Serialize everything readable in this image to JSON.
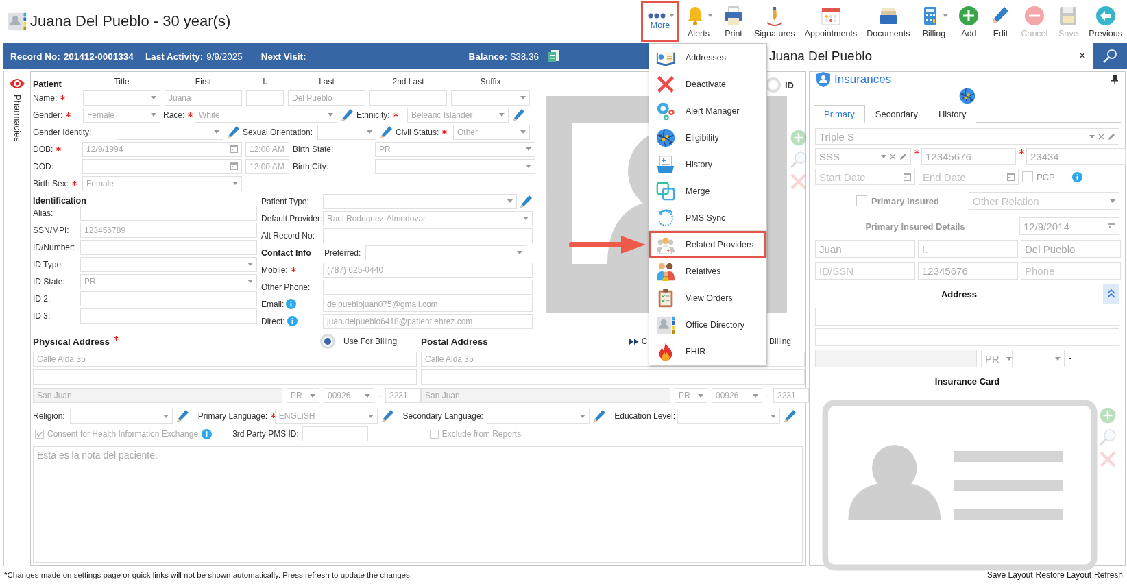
{
  "header": {
    "title": "Juana Del Pueblo - 30 year(s)"
  },
  "toolbar": [
    {
      "label": "More",
      "kind": "more",
      "dropdown": true,
      "highlighted": true,
      "disabled": false
    },
    {
      "label": "Alerts",
      "kind": "alerts",
      "dropdown": true,
      "highlighted": false,
      "disabled": false
    },
    {
      "label": "Print",
      "kind": "print",
      "dropdown": false,
      "highlighted": false,
      "disabled": false
    },
    {
      "label": "Signatures",
      "kind": "signatures",
      "dropdown": false,
      "highlighted": false,
      "disabled": false
    },
    {
      "label": "Appointments",
      "kind": "appointments",
      "dropdown": false,
      "highlighted": false,
      "disabled": false
    },
    {
      "label": "Documents",
      "kind": "documents",
      "dropdown": false,
      "highlighted": false,
      "disabled": false
    },
    {
      "label": "Billing",
      "kind": "billing",
      "dropdown": true,
      "highlighted": false,
      "disabled": false
    },
    {
      "label": "Add",
      "kind": "add",
      "dropdown": false,
      "highlighted": false,
      "disabled": false
    },
    {
      "label": "Edit",
      "kind": "edit",
      "dropdown": false,
      "highlighted": false,
      "disabled": false
    },
    {
      "label": "Cancel",
      "kind": "cancel",
      "dropdown": false,
      "highlighted": false,
      "disabled": true
    },
    {
      "label": "Save",
      "kind": "save",
      "dropdown": false,
      "highlighted": false,
      "disabled": true
    },
    {
      "label": "Previous",
      "kind": "previous",
      "dropdown": false,
      "highlighted": false,
      "disabled": false
    }
  ],
  "record_bar": {
    "record_label": "Record No:",
    "record_no": "201412-0001334",
    "activity_label": "Last Activity:",
    "last_activity": "9/9/2025",
    "next_visit_label": "Next Visit:",
    "balance_label": "Balance:",
    "balance": "$38.36"
  },
  "sidebar": {
    "label": "Pharmacies"
  },
  "more_menu": {
    "pointer_arrow": true,
    "items": [
      {
        "label": "Addresses",
        "kind": "addresses",
        "highlighted": false
      },
      {
        "label": "Deactivate",
        "kind": "deactivate",
        "highlighted": false
      },
      {
        "label": "Alert Manager",
        "kind": "alert_manager",
        "highlighted": false
      },
      {
        "label": "Eligibility",
        "kind": "eligibility",
        "highlighted": false
      },
      {
        "label": "History",
        "kind": "history",
        "highlighted": false
      },
      {
        "label": "Merge",
        "kind": "merge",
        "highlighted": false
      },
      {
        "label": "PMS Sync",
        "kind": "pms_sync",
        "highlighted": false
      },
      {
        "label": "Related Providers",
        "kind": "related_providers",
        "highlighted": true
      },
      {
        "label": "Relatives",
        "kind": "relatives",
        "highlighted": false
      },
      {
        "label": "View Orders",
        "kind": "view_orders",
        "highlighted": false
      },
      {
        "label": "Office Directory",
        "kind": "office_directory",
        "highlighted": false
      },
      {
        "label": "FHIR",
        "kind": "fhir",
        "highlighted": false
      }
    ]
  },
  "patient": {
    "heading": "Patient",
    "columns": [
      "Title",
      "First",
      "I.",
      "Last",
      "2nd Last",
      "Suffix"
    ],
    "name": {
      "label": "Name:",
      "required": true,
      "parts": [
        {
          "kind": "select"
        },
        {
          "kind": "text",
          "value": "Juana"
        },
        {
          "kind": "text"
        },
        {
          "kind": "text",
          "value": "Del Pueblo"
        },
        {
          "kind": "text"
        },
        {
          "kind": "select"
        }
      ]
    },
    "gender": {
      "label": "Gender:",
      "required": true,
      "kind": "select",
      "value": "Female"
    },
    "race": {
      "label": "Race:",
      "required": true,
      "kind": "select",
      "value": "White",
      "editable": true
    },
    "ethnicity": {
      "label": "Ethnicity:",
      "required": true,
      "kind": "select",
      "value": "Belearic Islander",
      "editable": true
    },
    "gender_identity": {
      "label": "Gender Identity:",
      "kind": "select",
      "editable": true
    },
    "sexual_orientation": {
      "label": "Sexual Orientation:",
      "kind": "select",
      "editable": true
    },
    "civil_status": {
      "label": "Civil Status:",
      "required": true,
      "kind": "select",
      "value": "Other"
    },
    "dob": {
      "label": "DOB:",
      "required": true,
      "kind": "date",
      "value": "12/9/1994",
      "time": "12:00 AM"
    },
    "birth_state": {
      "label": "Birth State:",
      "kind": "select",
      "value": "PR"
    },
    "dod": {
      "label": "DOD:",
      "kind": "date",
      "time": "12:00 AM"
    },
    "birth_city": {
      "label": "Birth City:",
      "kind": "select"
    },
    "birth_sex": {
      "label": "Birth Sex:",
      "required": true,
      "kind": "select",
      "value": "Female"
    }
  },
  "identification": {
    "heading": "Identification",
    "fields": [
      {
        "label": "Alias:",
        "kind": "text"
      },
      {
        "label": "SSN/MPI:",
        "kind": "text",
        "value": "123456789"
      },
      {
        "label": "ID/Number:",
        "kind": "text"
      },
      {
        "label": "ID Type:",
        "kind": "select"
      },
      {
        "label": "ID State:",
        "kind": "select",
        "value": "PR"
      },
      {
        "label": "ID 2:",
        "kind": "text"
      },
      {
        "label": "ID 3:",
        "kind": "text"
      }
    ]
  },
  "practice": {
    "fields": [
      {
        "label": "Patient Type:",
        "kind": "select",
        "editable": true
      },
      {
        "label": "Default Provider:",
        "kind": "select",
        "value": "Raul Rodriguez-Almodovar"
      },
      {
        "label": "Alt Record No:",
        "kind": "text"
      }
    ]
  },
  "contact": {
    "heading": "Contact Info",
    "preferred": {
      "label": "Preferred:",
      "kind": "select"
    },
    "fields": [
      {
        "label": "Mobile:",
        "required": true,
        "kind": "text",
        "value": "(787) 625-0440"
      },
      {
        "label": "Other Phone:",
        "kind": "text"
      },
      {
        "label": "Email:",
        "info": true,
        "kind": "text",
        "value": "delpueblojuan075@gmail.com"
      },
      {
        "label": "Direct:",
        "info": true,
        "kind": "text",
        "value": "juan.delpueblo6418@patient.ehrez.com"
      }
    ]
  },
  "photo": {
    "id_toggle": {
      "label": "ID",
      "on": false
    }
  },
  "physical_address": {
    "heading": "Physical Address",
    "required": true,
    "line1": "Calle Alda 35",
    "city": "San Juan",
    "state": "PR",
    "zip": "00926",
    "separator": "-",
    "zip_ext": "2231"
  },
  "use_for_billing": {
    "label": "Use For Billing",
    "selected": true
  },
  "postal_address": {
    "heading": "Postal Address",
    "line1": "Calle Alda 35",
    "city": "San Juan",
    "state": "PR",
    "zip": "00926",
    "separator": "-",
    "zip_ext": "2231",
    "copy_link": "C",
    "billing_option": "Billing"
  },
  "languages": [
    {
      "label": "Religion:",
      "kind": "select",
      "editable": true
    },
    {
      "label": "Primary Language:",
      "required": true,
      "kind": "select",
      "value": "ENGLISH",
      "editable": true
    },
    {
      "label": "Secondary Language:",
      "kind": "select",
      "editable": true
    },
    {
      "label": "Education Level:",
      "kind": "select",
      "editable": true
    }
  ],
  "options": {
    "consent": {
      "label": "Consent for Health Information Exchange",
      "checked": true,
      "info": true
    },
    "third_party": {
      "label": "3rd Party PMS ID:",
      "kind": "text"
    },
    "exclude": {
      "label": "Exclude from Reports",
      "checked": false
    }
  },
  "notes": {
    "value": "Esta es la nota del paciente."
  },
  "side_panel": {
    "title": "Juana Del Pueblo",
    "close": "×"
  },
  "insurances": {
    "title": "Insurances",
    "tabs": [
      {
        "label": "Primary",
        "selected": true
      },
      {
        "label": "Secondary",
        "selected": false
      },
      {
        "label": "History",
        "selected": false
      }
    ],
    "plan": {
      "kind": "select",
      "value": "Triple S"
    },
    "payer": {
      "kind": "select",
      "value": "SSS"
    },
    "member_id": {
      "kind": "text",
      "value": "12345676",
      "required": true
    },
    "group": {
      "kind": "text",
      "value": "23434",
      "required": true
    },
    "start_date": {
      "kind": "date",
      "placeholder": "Start Date"
    },
    "end_date": {
      "kind": "date",
      "placeholder": "End Date"
    },
    "pcp": {
      "label": "PCP",
      "checked": false
    },
    "primary_insured": {
      "label": "Primary Insured",
      "checked": false
    },
    "relation": {
      "kind": "select",
      "placeholder": "Other Relation"
    },
    "details_label": "Primary Insured Details",
    "insured_dob": {
      "kind": "date",
      "value": "12/9/2014"
    },
    "insured": [
      {
        "kind": "text",
        "value": "Juan"
      },
      {
        "kind": "text",
        "placeholder": "I."
      },
      {
        "kind": "text",
        "value": "Del Pueblo"
      },
      {
        "kind": "text",
        "placeholder": "ID/SSN"
      },
      {
        "kind": "text",
        "value": "12345676"
      },
      {
        "kind": "text",
        "placeholder": "Phone"
      }
    ],
    "address_heading": "Address",
    "address": {
      "state": "PR",
      "separator": "-"
    },
    "card_heading": "Insurance Card"
  },
  "footer": {
    "note": "*Changes made on settings page or quick links will not be shown automatically. Press refresh to update the changes.",
    "links": [
      "Save Layout",
      "Restore Layout",
      "Refresh"
    ]
  }
}
